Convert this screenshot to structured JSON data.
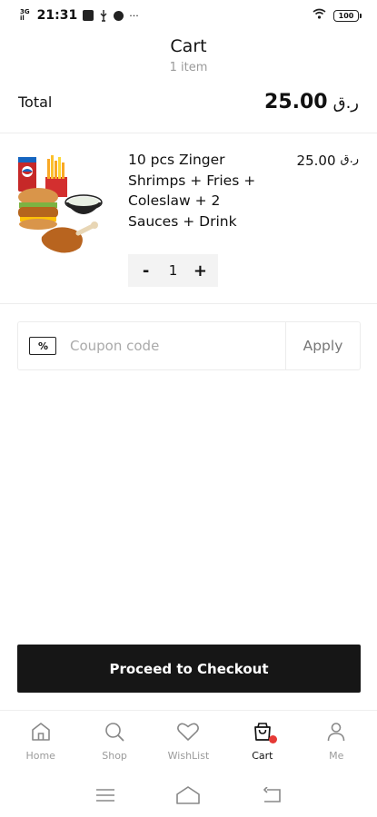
{
  "status_bar": {
    "signal_top": "3G",
    "signal_bottom": "il",
    "time": "21:31",
    "battery": "100",
    "more": "···"
  },
  "header": {
    "title": "Cart",
    "subtitle": "1 item"
  },
  "total": {
    "label": "Total",
    "amount": "25.00",
    "currency": "ر.ق"
  },
  "cart_items": [
    {
      "name": "10 pcs Zinger Shrimps + Fries + Coleslaw + 2 Sauces + Drink",
      "price": "25.00",
      "currency": "ر.ق",
      "quantity": "1",
      "minus_label": "-",
      "plus_label": "+"
    }
  ],
  "coupon": {
    "icon_text": "%",
    "placeholder": "Coupon code",
    "value": "",
    "apply_label": "Apply"
  },
  "checkout": {
    "label": "Proceed to Checkout"
  },
  "bottom_nav": {
    "items": [
      {
        "label": "Home",
        "icon": "home-icon",
        "active": false
      },
      {
        "label": "Shop",
        "icon": "search-icon",
        "active": false
      },
      {
        "label": "WishList",
        "icon": "heart-icon",
        "active": false
      },
      {
        "label": "Cart",
        "icon": "bag-icon",
        "active": true
      },
      {
        "label": "Me",
        "icon": "user-icon",
        "active": false
      }
    ]
  },
  "colors": {
    "accent": "#161616",
    "badge": "#e53935",
    "muted": "#9a9a9a"
  }
}
